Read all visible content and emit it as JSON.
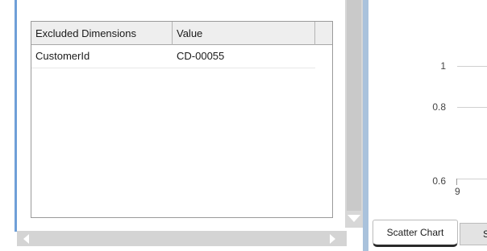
{
  "excluded_table": {
    "columns": [
      "Excluded Dimensions",
      "Value",
      ""
    ],
    "rows": [
      {
        "dimension": "CustomerId",
        "value": "CD-00055"
      }
    ]
  },
  "chart": {
    "y_ticks": [
      "1",
      "0.8",
      "0.6"
    ],
    "x_tick": "9"
  },
  "tabs": [
    {
      "label": "Scatter Chart",
      "selected": true
    },
    {
      "label": "S",
      "selected": false
    }
  ]
}
